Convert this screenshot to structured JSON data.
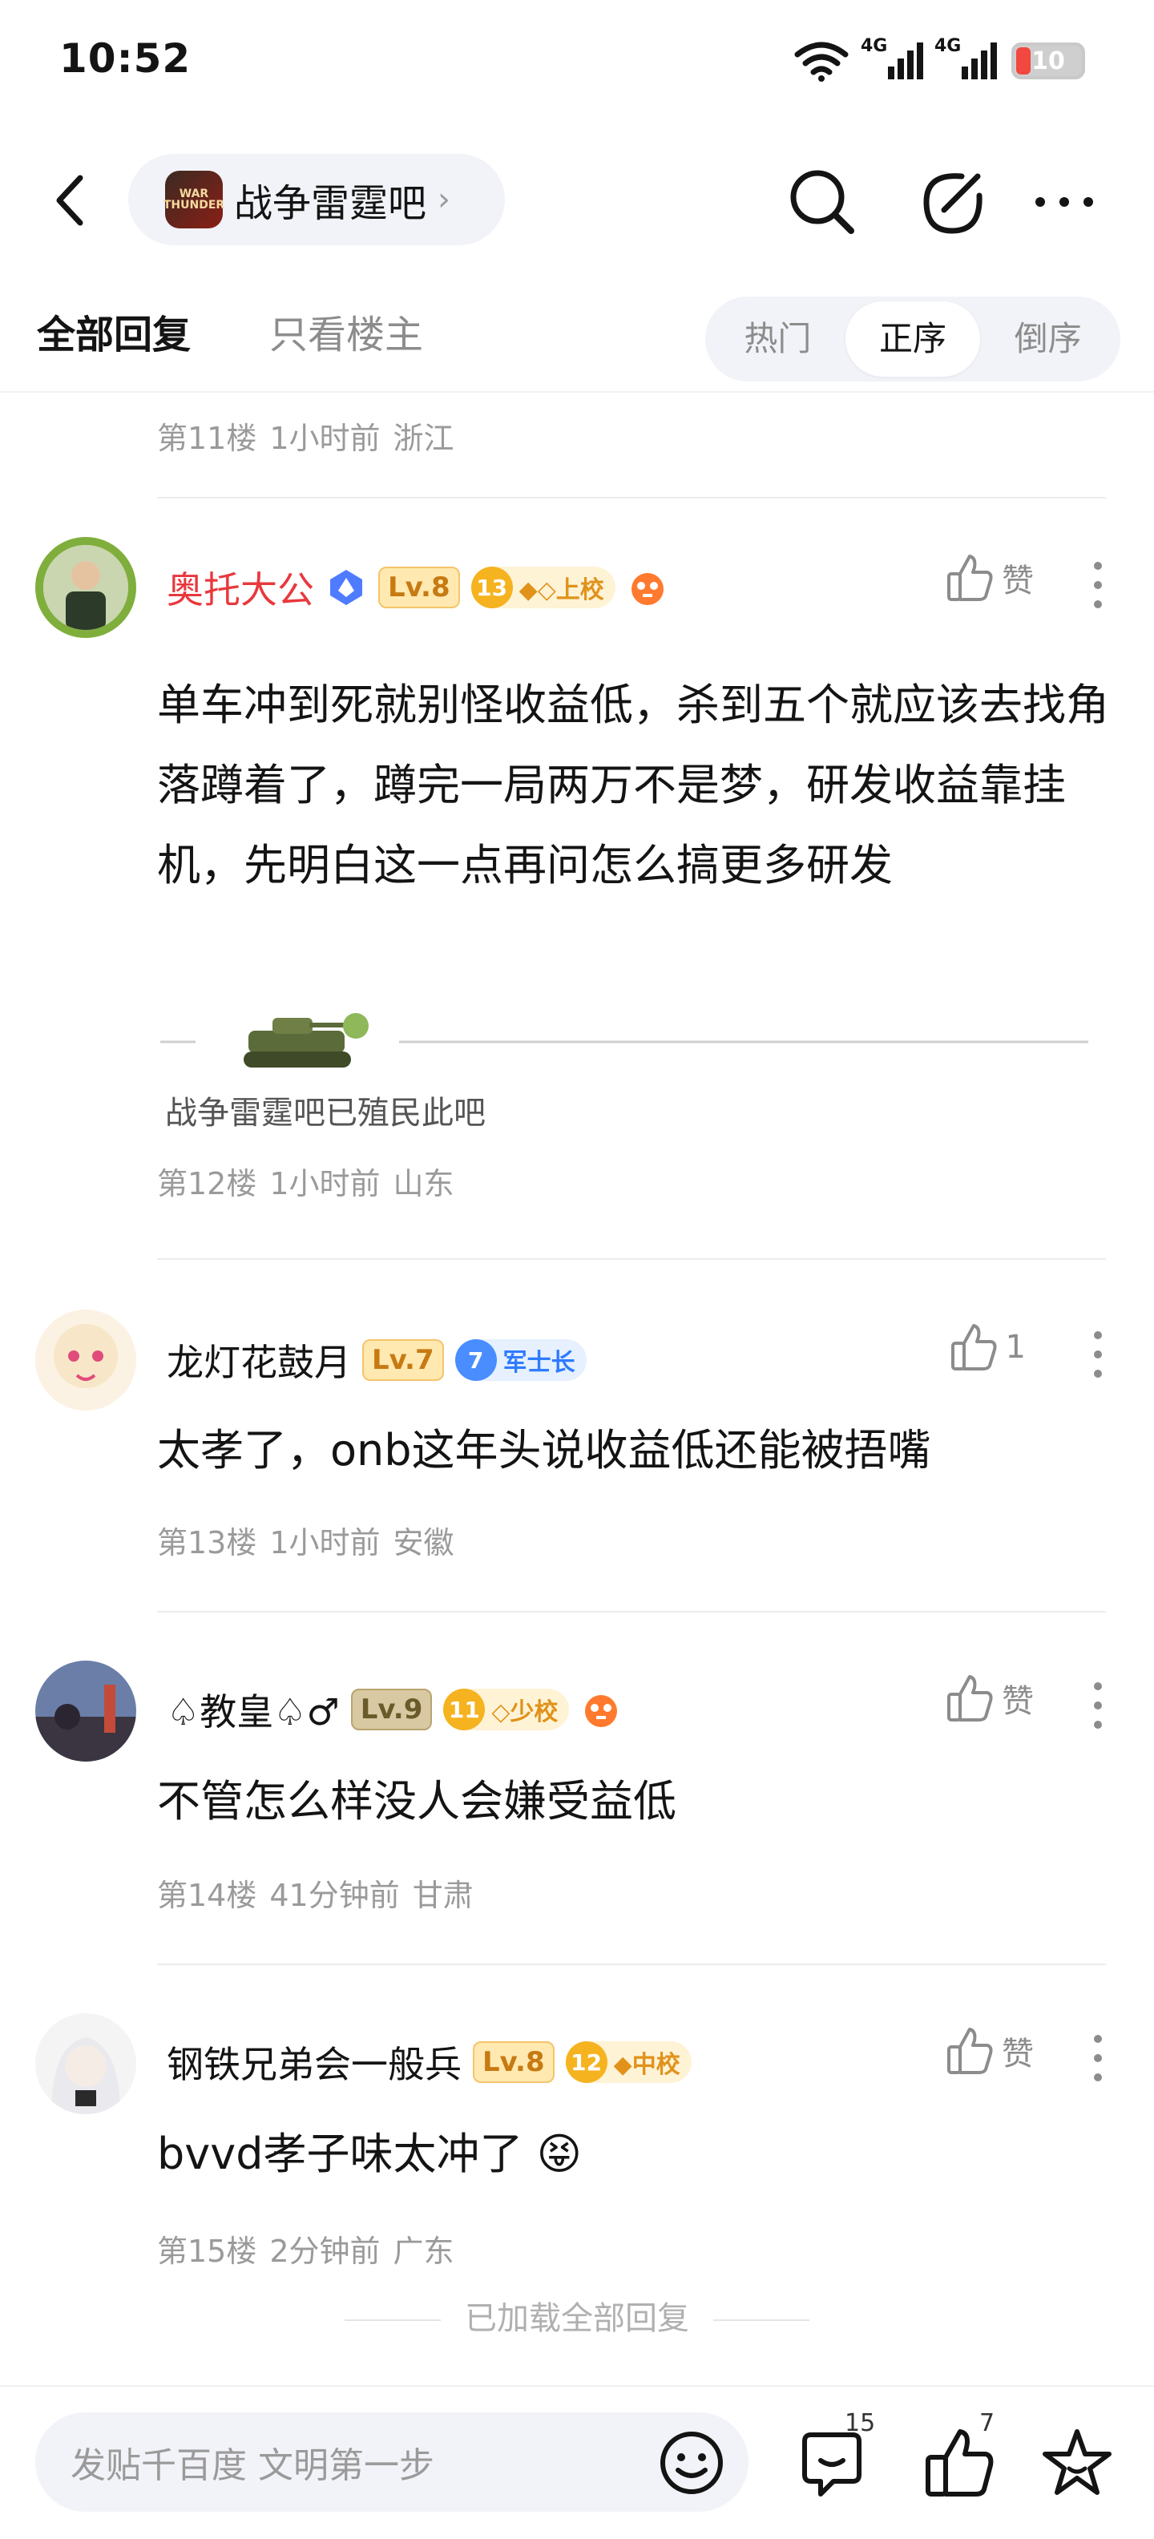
{
  "status_bar": {
    "time": "10:52",
    "network_1": "4G",
    "network_2": "4G",
    "battery": "10"
  },
  "header": {
    "forum_name": "战争雷霆吧",
    "forum_logo_text": "WAR THUNDER"
  },
  "tabs": {
    "all_replies": "全部回复",
    "owner_only": "只看楼主",
    "sort_options": [
      "热门",
      "正序",
      "倒序"
    ],
    "active_sort": "正序"
  },
  "posts": [
    {
      "floor": "第11楼",
      "time": "1小时前",
      "location": "浙江"
    },
    {
      "username": "奥托大公",
      "level": "Lv.8",
      "rank_num": "13",
      "rank_title": "◆◇上校",
      "like": "赞",
      "content": "单车冲到死就别怪收益低，杀到五个就应该去找角落蹲着了，蹲完一局两万不是梦，研发收益靠挂机，先明白这一点再问怎么搞更多研发",
      "signature": "战争雷霆吧已殖民此吧",
      "floor": "第12楼",
      "time": "1小时前",
      "location": "山东"
    },
    {
      "username": "龙灯花鼓月",
      "level": "Lv.7",
      "rank_num": "7",
      "rank_title": "军士长",
      "like": "1",
      "content": "太孝了，onb这年头说收益低还能被捂嘴",
      "floor": "第13楼",
      "time": "1小时前",
      "location": "安徽"
    },
    {
      "username": "♤教皇♤♂",
      "level": "Lv.9",
      "rank_num": "11",
      "rank_title": "◇少校",
      "like": "赞",
      "content": "不管怎么样没人会嫌受益低",
      "floor": "第14楼",
      "time": "41分钟前",
      "location": "甘肃"
    },
    {
      "username": "钢铁兄弟会一般兵",
      "level": "Lv.8",
      "rank_num": "12",
      "rank_title": "◆中校",
      "like": "赞",
      "content": "bvvd孝子味太冲了 😝",
      "floor": "第15楼",
      "time": "2分钟前",
      "location": "广东"
    }
  ],
  "load_all": "已加载全部回复",
  "bottom_bar": {
    "placeholder": "发贴千百度 文明第一步",
    "comment_count": "15",
    "like_count": "7"
  },
  "colors": {
    "vip_name": "#e8383d",
    "accent_blue": "#2f7bff",
    "rank_gold": "#f5b31f"
  }
}
